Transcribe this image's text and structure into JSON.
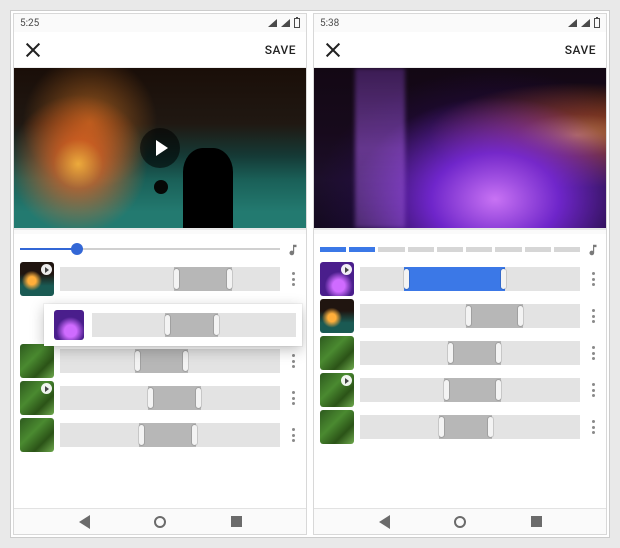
{
  "screens": [
    {
      "status": {
        "time": "5:25"
      },
      "appbar": {
        "save_label": "SAVE"
      },
      "slider": {
        "type": "continuous",
        "value_pct": 22
      },
      "video": {
        "style": "hot-spring-pool",
        "has_play_overlay": true
      },
      "clips": [
        {
          "thumb": "pool",
          "sel_start_pct": 52,
          "sel_end_pct": 78,
          "color": "grey",
          "has_play": true
        },
        {
          "thumb": "purple",
          "sel_start_pct": 36,
          "sel_end_pct": 62,
          "color": "grey",
          "has_play": false,
          "floating": true
        },
        {
          "thumb": "leaf",
          "sel_start_pct": 34,
          "sel_end_pct": 58,
          "color": "grey",
          "has_play": false
        },
        {
          "thumb": "leaf",
          "sel_start_pct": 40,
          "sel_end_pct": 64,
          "color": "grey",
          "has_play": true
        },
        {
          "thumb": "leaf",
          "sel_start_pct": 36,
          "sel_end_pct": 62,
          "color": "grey",
          "has_play": false
        }
      ]
    },
    {
      "status": {
        "time": "5:38"
      },
      "appbar": {
        "save_label": "SAVE"
      },
      "slider": {
        "type": "segmented",
        "segments_total": 9,
        "segments_on": 2
      },
      "video": {
        "style": "cave-purple",
        "has_play_overlay": false
      },
      "clips": [
        {
          "thumb": "purple",
          "sel_start_pct": 20,
          "sel_end_pct": 66,
          "color": "blue",
          "has_play": true
        },
        {
          "thumb": "pool",
          "sel_start_pct": 48,
          "sel_end_pct": 74,
          "color": "grey",
          "has_play": false
        },
        {
          "thumb": "leaf",
          "sel_start_pct": 40,
          "sel_end_pct": 64,
          "color": "grey",
          "has_play": false
        },
        {
          "thumb": "leaf",
          "sel_start_pct": 38,
          "sel_end_pct": 64,
          "color": "grey",
          "has_play": true
        },
        {
          "thumb": "leaf",
          "sel_start_pct": 36,
          "sel_end_pct": 60,
          "color": "grey",
          "has_play": false
        }
      ]
    }
  ],
  "colors": {
    "accent": "#3b78e7",
    "accent_dark": "#3367d6",
    "track": "#e3e3e3",
    "sel_grey": "#b7b7b7"
  }
}
